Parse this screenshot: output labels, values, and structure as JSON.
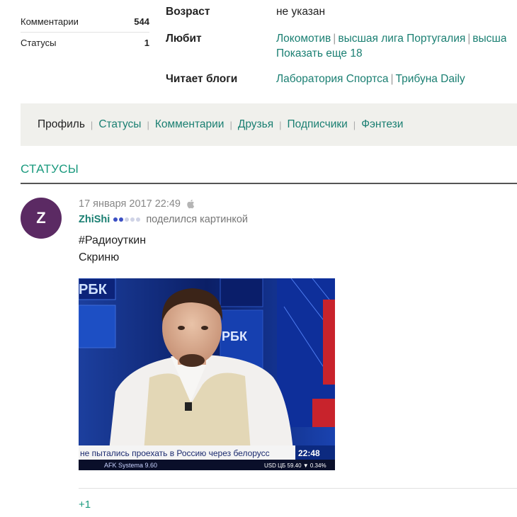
{
  "stats": [
    {
      "label": "Комментарии",
      "count": "544"
    },
    {
      "label": "Статусы",
      "count": "1"
    }
  ],
  "info": {
    "age_label": "Возраст",
    "age_value": "не указан",
    "likes_label": "Любит",
    "likes": [
      "Локомотив",
      "высшая лига Португалия",
      "высша"
    ],
    "show_more": "Показать еще 18",
    "blogs_label": "Читает блоги",
    "blogs": [
      "Лаборатория Спортса",
      "Трибуна Daily"
    ]
  },
  "nav": [
    "Профиль",
    "Статусы",
    "Комментарии",
    "Друзья",
    "Подписчики",
    "Фэнтези"
  ],
  "section_title": "СТАТУСЫ",
  "post": {
    "avatar_letter": "Z",
    "datetime": "17 января 2017 22:49",
    "platform_icon": "apple-icon",
    "author": "ZhiShi",
    "rating_dots": {
      "filled": 2,
      "total": 5
    },
    "action": "поделился картинкой",
    "line1": "#Радиоуткин",
    "line2": "Скриню",
    "image": {
      "channel_logo": "РБК",
      "ticker_text": "не пытались проехать в Россию через белорусс",
      "ticker_time": "22:48",
      "ticker_bottom_left": "AFK Systema 9.60",
      "ticker_usd": "USD ЦБ 59.40 ▼ 0.34%"
    },
    "plus": "+1"
  },
  "colors": {
    "accent": "#1a7f72",
    "section_title": "#1a9a7e",
    "avatar_bg": "#5b2a63",
    "navbar_bg": "#f0f0ec"
  }
}
